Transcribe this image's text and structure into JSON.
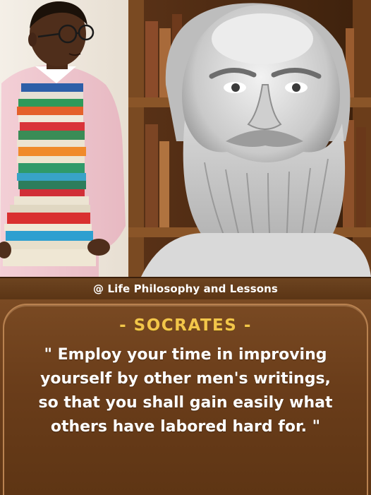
{
  "credit": "@ Life Philosophy and Lessons",
  "author": "- SOCRATES -",
  "quote_lines": [
    "\" Employ your time in improving",
    "yourself by other men's writings,",
    "so that you shall gain easily what",
    "others have labored hard for. \""
  ],
  "colors": {
    "panel_brown": "#6a3d1a",
    "author_gold": "#f3c64a",
    "quote_white": "#ffffff"
  }
}
